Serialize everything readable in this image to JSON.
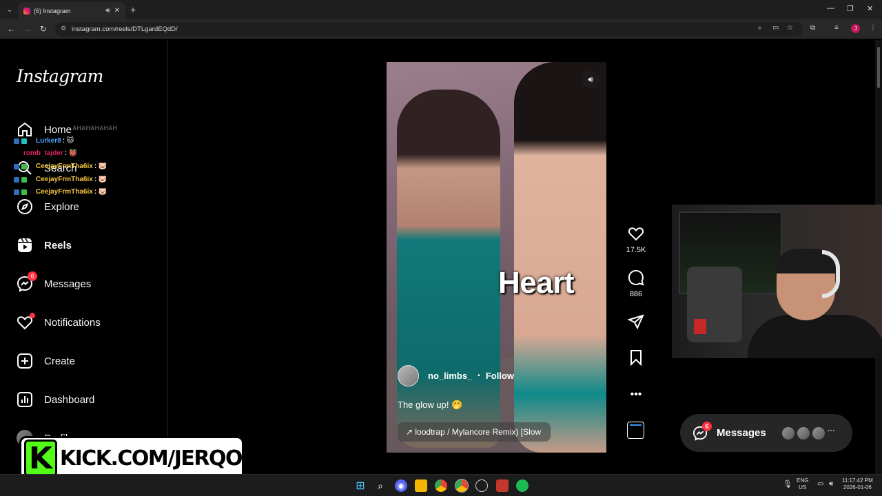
{
  "browser": {
    "tab_title": "(6) Instagram",
    "url": "instagram.com/reels/DTLgardEQdD/",
    "new_tab": "+",
    "minimize": "—",
    "restore": "❐",
    "close": "✕",
    "profile_initial": "J"
  },
  "sidebar": {
    "logo": "Instagram",
    "items": [
      {
        "label": "Home",
        "icon": "home-icon"
      },
      {
        "label": "Search",
        "icon": "search-icon"
      },
      {
        "label": "Explore",
        "icon": "compass-icon"
      },
      {
        "label": "Reels",
        "icon": "reels-icon"
      },
      {
        "label": "Messages",
        "icon": "messenger-icon",
        "badge": "6"
      },
      {
        "label": "Notifications",
        "icon": "heart-icon"
      },
      {
        "label": "Create",
        "icon": "plus-square-icon"
      },
      {
        "label": "Dashboard",
        "icon": "chart-icon"
      },
      {
        "label": "Profile",
        "icon": "avatar"
      }
    ]
  },
  "chat_overlay": {
    "faded_line": "AHAHAHAHAH",
    "messages": [
      {
        "user": "Lurker8",
        "color": "#4fa3ff"
      },
      {
        "user": "romb_tajder",
        "color": "#e0245e"
      },
      {
        "user": "CeejayFrmTha6ix",
        "color": "#f4c542"
      },
      {
        "user": "CeejayFrmTha6ix",
        "color": "#f4c542"
      },
      {
        "user": "CeejayFrmTha6ix",
        "color": "#f4c542"
      }
    ]
  },
  "reel": {
    "overlay_text": "Heart",
    "username": "no_limbs_",
    "separator": "•",
    "follow": "Follow",
    "caption": "The glow up! 🤭",
    "audio": "↗ loodtrap / Mylancore Remix) [Slow",
    "likes": "17.5K",
    "comments": "886"
  },
  "messages_pill": {
    "label": "Messages",
    "badge": "6",
    "more": "···"
  },
  "stream": {
    "banner_letter": "K",
    "banner_url": "KICK.COM/JERQO"
  },
  "taskbar": {
    "lang1": "ENG",
    "lang2": "US",
    "time": "11:17:42 PM",
    "date": "2026-01-06"
  }
}
